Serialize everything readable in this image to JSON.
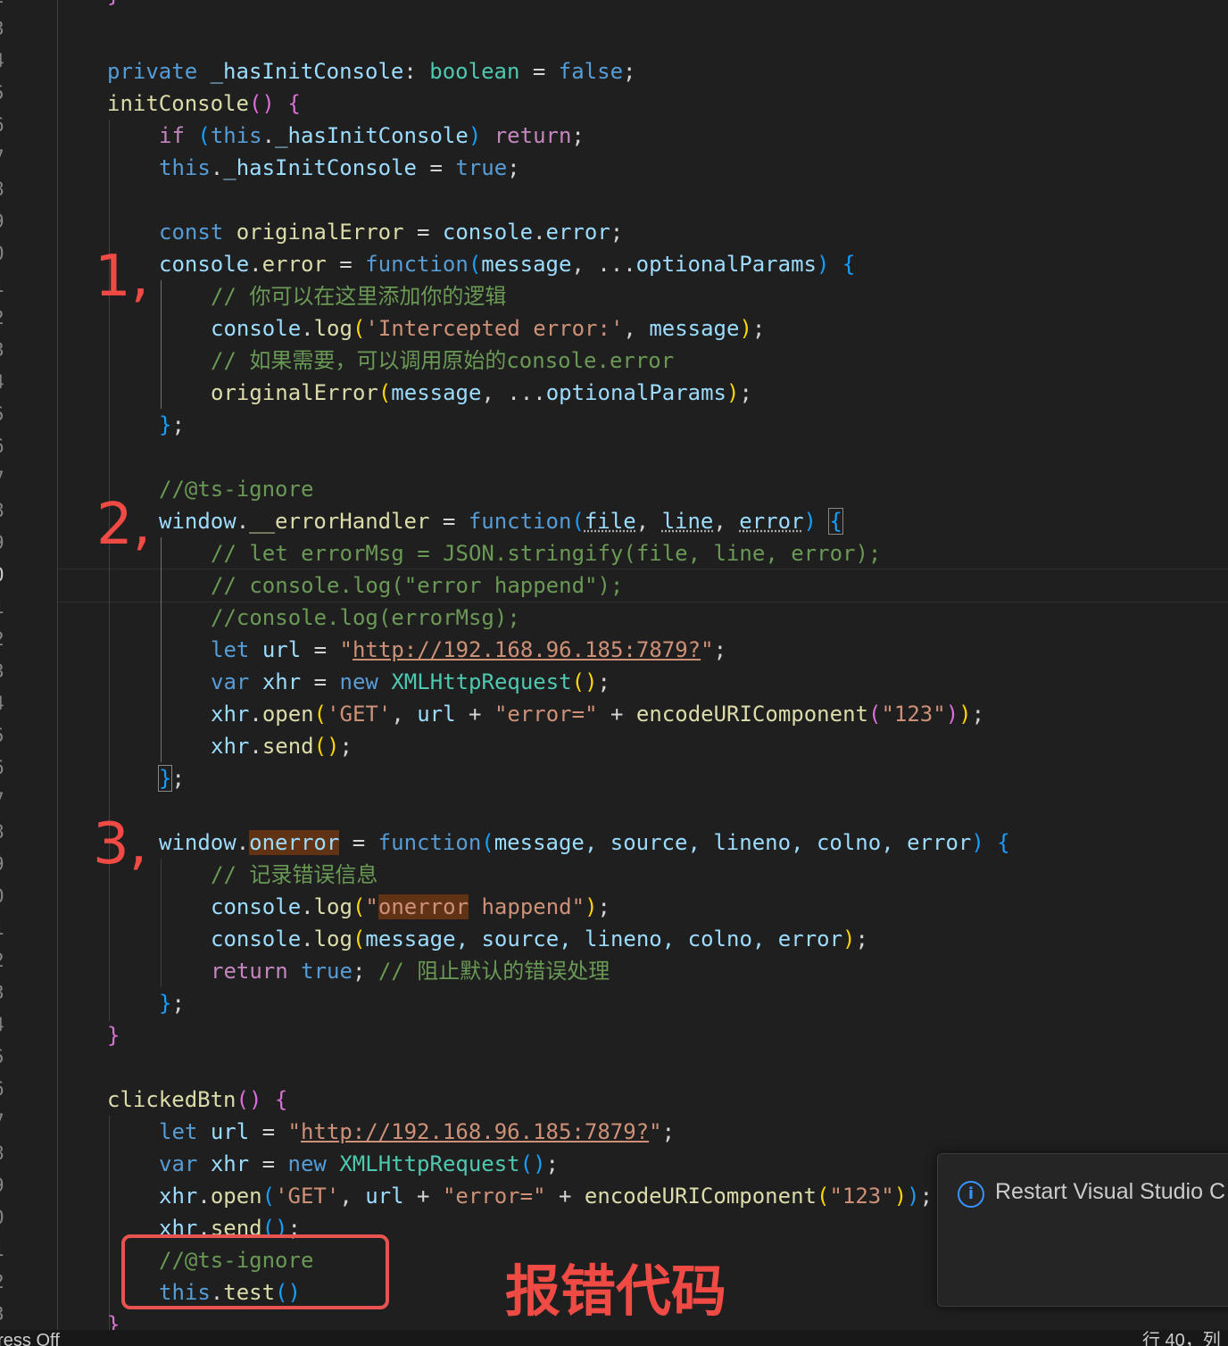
{
  "editor": {
    "line_numbers": [
      "2",
      "3",
      "4",
      "5",
      "6",
      "7",
      "8",
      "9",
      "0",
      "1",
      "2",
      "3",
      "4",
      "5",
      "6",
      "7",
      "8",
      "9",
      "0",
      "1",
      "2",
      "3",
      "4",
      "5",
      "6",
      "7",
      "8",
      "9",
      "0",
      "1",
      "2",
      "3",
      "4",
      "5",
      "6",
      "7",
      "8",
      "9",
      "0",
      "1",
      "2",
      "3",
      "4"
    ],
    "current_line_index": 18,
    "code": {
      "l3_private": "private",
      "l3_name": "_hasInitConsole",
      "l3_colon": ": ",
      "l3_type": "boolean",
      "l3_eq": " = ",
      "l3_val": "false",
      "l3_end": ";",
      "l4_name": "initConsole",
      "l4_par": "()",
      "l4_sp": " ",
      "l4_brace": "{",
      "l5_if": "if",
      "l5_sp": " ",
      "l5_po": "(",
      "l5_this": "this",
      "l5_dot": ".",
      "l5_name": "_hasInitConsole",
      "l5_pc": ")",
      "l5_sp2": " ",
      "l5_ret": "return",
      "l5_end": ";",
      "l6_this": "this",
      "l6_dot": ".",
      "l6_name": "_hasInitConsole",
      "l6_eq": " = ",
      "l6_val": "true",
      "l6_end": ";",
      "l8_const": "const",
      "l8_sp": " ",
      "l8_name": "originalError",
      "l8_eq": " = ",
      "l8_con": "console",
      "l8_dot": ".",
      "l8_err": "error",
      "l8_end": ";",
      "l9_con": "console",
      "l9_dot": ".",
      "l9_err": "error",
      "l9_eq": " = ",
      "l9_fn": "function",
      "l9_po": "(",
      "l9_msg": "message",
      "l9_comma": ", ...",
      "l9_opt": "optionalParams",
      "l9_pc": ")",
      "l9_sp": " ",
      "l9_brace": "{",
      "l10_cm": "// 你可以在这里添加你的逻辑",
      "l11_con": "console",
      "l11_dot": ".",
      "l11_log": "log",
      "l11_po": "(",
      "l11_str": "'Intercepted error:'",
      "l11_comma": ", ",
      "l11_msg": "message",
      "l11_pc": ")",
      "l11_end": ";",
      "l12_cm": "// 如果需要，可以调用原始的console.error",
      "l13_fn": "originalError",
      "l13_po": "(",
      "l13_msg": "message",
      "l13_comma": ", ...",
      "l13_opt": "optionalParams",
      "l13_pc": ")",
      "l13_end": ";",
      "l14_brace": "}",
      "l14_end": ";",
      "l16_cm": "//@ts-ignore",
      "l17_win": "window",
      "l17_dot": ".",
      "l17_name": "__errorHandler",
      "l17_eq": " = ",
      "l17_fn": "function",
      "l17_po": "(",
      "l17_file": "file",
      "l17_c1": ", ",
      "l17_line": "line",
      "l17_c2": ", ",
      "l17_err": "error",
      "l17_pc": ")",
      "l17_sp": " ",
      "l17_brace": "{",
      "l18_cm": "// let errorMsg = JSON.stringify(file, line, error);",
      "l19_cm": "// console.log(\"error happend\");",
      "l20_cm": "//console.log(errorMsg);",
      "l21_let": "let",
      "l21_sp": " ",
      "l21_url": "url",
      "l21_eq": " = ",
      "l21_q1": "\"",
      "l21_link": "http://192.168.96.185:7879?",
      "l21_q2": "\"",
      "l21_end": ";",
      "l22_var": "var",
      "l22_sp": " ",
      "l22_xhr": "xhr",
      "l22_eq": " = ",
      "l22_new": "new",
      "l22_sp2": " ",
      "l22_cls": "XMLHttpRequest",
      "l22_par": "()",
      "l22_end": ";",
      "l23_xhr": "xhr",
      "l23_dot": ".",
      "l23_open": "open",
      "l23_po": "(",
      "l23_get": "'GET'",
      "l23_c1": ", ",
      "l23_url": "url",
      "l23_plus": " + ",
      "l23_str": "\"error=\"",
      "l23_plus2": " + ",
      "l23_enc": "encodeURIComponent",
      "l23_po2": "(",
      "l23_num": "\"123\"",
      "l23_pc2": ")",
      "l23_pc": ")",
      "l23_end": ";",
      "l24_xhr": "xhr",
      "l24_dot": ".",
      "l24_send": "send",
      "l24_par": "()",
      "l24_end": ";",
      "l25_brace": "}",
      "l25_end": ";",
      "l27_win": "window",
      "l27_dot": ".",
      "l27_on": "onerror",
      "l27_eq": " = ",
      "l27_fn": "function",
      "l27_po": "(",
      "l27_params": "message, source, lineno, colno, error",
      "l27_pc": ")",
      "l27_sp": " ",
      "l27_brace": "{",
      "l28_cm": "// 记录错误信息",
      "l29_con": "console",
      "l29_dot": ".",
      "l29_log": "log",
      "l29_po": "(",
      "l29_q": "\"",
      "l29_on": "onerror",
      "l29_rest": " happend\"",
      "l29_pc": ")",
      "l29_end": ";",
      "l30_con": "console",
      "l30_dot": ".",
      "l30_log": "log",
      "l30_po": "(",
      "l30_params": "message, source, lineno, colno, error",
      "l30_pc": ")",
      "l30_end": ";",
      "l31_ret": "return",
      "l31_sp": " ",
      "l31_true": "true",
      "l31_semi": "; ",
      "l31_cm": "// 阻止默认的错误处理",
      "l32_brace": "}",
      "l32_end": ";",
      "l33_brace": "}",
      "l35_name": "clickedBtn",
      "l35_par": "()",
      "l35_sp": " ",
      "l35_brace": "{",
      "l39_xhr": "xhr",
      "l39_dot": ".",
      "l39_send": "send",
      "l39_par": "()",
      "l39_end": ";",
      "l40_cm": "//@ts-ignore",
      "l41_this": "this",
      "l41_dot": ".",
      "l41_test": "test",
      "l41_par": "()",
      "l42_brace": "}"
    }
  },
  "annotations": {
    "mark1": "1,",
    "mark2": "2,",
    "mark3": "3,",
    "error_code_label": "报错代码"
  },
  "notification": {
    "icon": "info-icon",
    "message": "Restart Visual Studio C"
  },
  "statusbar": {
    "left": "press Off",
    "right": "行 40，列"
  },
  "colors": {
    "background": "#1f1f1f",
    "keyword": "#569cd6",
    "control": "#c586c0",
    "type": "#4ec9b0",
    "function": "#dcdcaa",
    "variable": "#9cdcfe",
    "string": "#ce9178",
    "comment": "#6a9955",
    "annotation_red": "#f04a45"
  }
}
